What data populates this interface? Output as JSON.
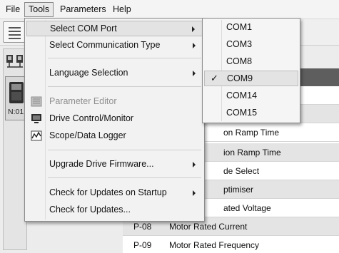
{
  "menubar": {
    "items": [
      {
        "label": "File",
        "name": "menu-file"
      },
      {
        "label": "Tools",
        "name": "menu-tools"
      },
      {
        "label": "Parameters",
        "name": "menu-parameters"
      },
      {
        "label": "Help",
        "name": "menu-help"
      }
    ]
  },
  "left_pane": {
    "drive_label": "N:01"
  },
  "tools_menu": {
    "items": [
      {
        "label": "Select COM Port",
        "submenu": true,
        "icon": ""
      },
      {
        "label": "Select Communication Type",
        "submenu": true,
        "icon": ""
      },
      {
        "label": "Language Selection",
        "submenu": true,
        "icon": ""
      },
      {
        "label": "Parameter Editor",
        "disabled": true,
        "icon": "parameter-editor-icon"
      },
      {
        "label": "Drive Control/Monitor",
        "icon": "monitor-icon"
      },
      {
        "label": "Scope/Data Logger",
        "icon": "scope-icon"
      },
      {
        "label": "Upgrade Drive Firmware...",
        "submenu": true,
        "icon": ""
      },
      {
        "label": "Check for Updates on Startup",
        "submenu": true,
        "icon": ""
      },
      {
        "label": "Check for Updates...",
        "icon": ""
      }
    ]
  },
  "com_submenu": {
    "items": [
      {
        "label": "COM1",
        "checked": false
      },
      {
        "label": "COM3",
        "checked": false
      },
      {
        "label": "COM8",
        "checked": false
      },
      {
        "label": "COM9",
        "checked": true
      },
      {
        "label": "COM14",
        "checked": false
      },
      {
        "label": "COM15",
        "checked": false
      }
    ],
    "check_glyph": "✓"
  },
  "parameters": {
    "rows": [
      {
        "code": "",
        "name": "on Ramp Time"
      },
      {
        "code": "",
        "name": "ion Ramp Time"
      },
      {
        "code": "",
        "name": "de Select"
      },
      {
        "code": "",
        "name": "ptimiser"
      },
      {
        "code": "",
        "name": "ated Voltage"
      },
      {
        "code": "P-08",
        "name": "Motor Rated Current"
      },
      {
        "code": "P-09",
        "name": "Motor Rated Frequency"
      }
    ]
  },
  "colors": {
    "table_header": "#5e5e5e",
    "row_alt": "#e4e4e4",
    "menu_bg": "#f2f2f2",
    "highlight": "#e3e3e3"
  }
}
